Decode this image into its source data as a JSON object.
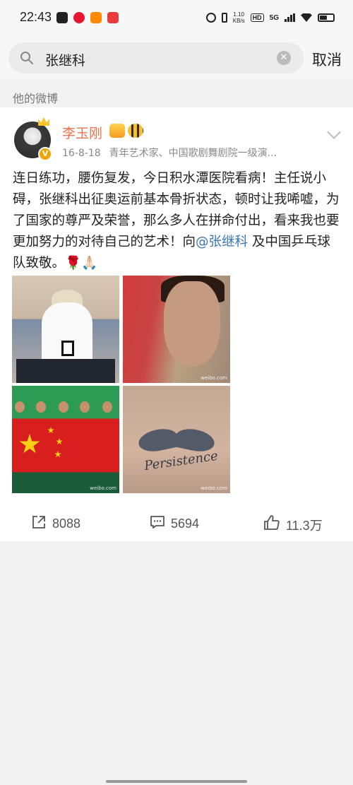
{
  "status_bar": {
    "time": "22:43",
    "net_speed_value": "1.10",
    "net_speed_unit": "KB/s",
    "hd_label": "HD",
    "signal_label": "5G"
  },
  "search": {
    "query": "张继科",
    "cancel_label": "取消"
  },
  "section_label": "他的微博",
  "post": {
    "author": "李玉刚",
    "date": "16-8-18",
    "source": "青年艺术家、中国歌剧舞剧院一级演...",
    "text_part1": "连日练功，腰伤复发，今日积水潭医院看病！主任说小碍，张继科出征奥运前基本骨折状态，顿时让我唏嘘，为了国家的尊严及荣誉，那么多人在拼命付出，看来我也要更加努力的对待自己的艺术！向",
    "mention": "@张继科",
    "text_part2": " 及中国乒乓球队致敬。🌹🙏🏻",
    "photos": [
      "photo-performer",
      "photo-athlete-portrait",
      "photo-team-flag",
      "photo-tattoo"
    ],
    "watermark": "weibo.com",
    "tattoo_text": "Persistence",
    "reposts": "8088",
    "comments": "5694",
    "likes": "11.3万"
  },
  "icons": {
    "search": "search-icon",
    "clear": "clear-icon",
    "repost": "repost-icon",
    "comment": "comment-icon",
    "like": "thumbs-up-icon",
    "more": "chevron-down-icon"
  }
}
